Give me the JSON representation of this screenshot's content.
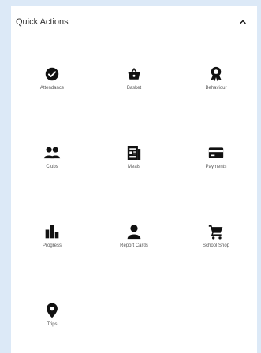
{
  "panel": {
    "title": "Quick Actions",
    "toggle_icon": "chevron-up-icon"
  },
  "actions": [
    {
      "label": "Attendance",
      "icon": "check-circle-icon"
    },
    {
      "label": "Basket",
      "icon": "basket-icon"
    },
    {
      "label": "Behaviour",
      "icon": "award-icon"
    },
    {
      "label": "Clubs",
      "icon": "people-icon"
    },
    {
      "label": "Meals",
      "icon": "newspaper-icon"
    },
    {
      "label": "Payments",
      "icon": "credit-card-icon"
    },
    {
      "label": "Progress",
      "icon": "bar-chart-icon"
    },
    {
      "label": "Report Cards",
      "icon": "person-icon"
    },
    {
      "label": "School Shop",
      "icon": "shopping-cart-icon"
    },
    {
      "label": "Trips",
      "icon": "map-pin-icon"
    }
  ],
  "colors": {
    "background": "#dce9f7",
    "panel": "#ffffff",
    "icon": "#111111",
    "label": "#555555"
  }
}
